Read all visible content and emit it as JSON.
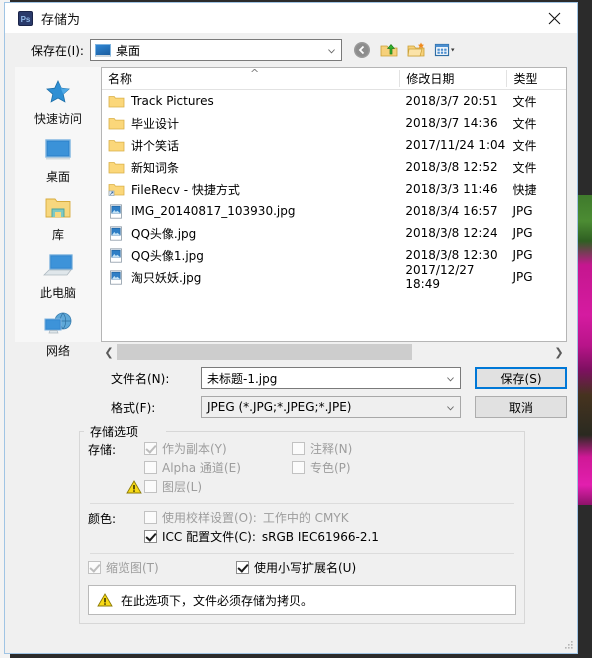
{
  "window": {
    "title": "存储为",
    "app_icon": "Ps",
    "close_icon": "close-icon"
  },
  "toolbar": {
    "save_in_label": "保存在(I):",
    "location_value": "桌面",
    "buttons": [
      {
        "name": "back-button",
        "icon": "back-arrow-icon",
        "label": ""
      },
      {
        "name": "up-one-level-button",
        "icon": "folder-up-icon",
        "label": ""
      },
      {
        "name": "new-folder-button",
        "icon": "new-folder-icon",
        "label": ""
      },
      {
        "name": "view-menu-button",
        "icon": "view-grid-icon",
        "label": ""
      }
    ]
  },
  "places": [
    {
      "label": "快速访问",
      "icon": "star-icon"
    },
    {
      "label": "桌面",
      "icon": "desktop-icon"
    },
    {
      "label": "库",
      "icon": "library-folder-icon"
    },
    {
      "label": "此电脑",
      "icon": "this-pc-icon"
    },
    {
      "label": "网络",
      "icon": "network-icon"
    }
  ],
  "filelist": {
    "columns": [
      "名称",
      "修改日期",
      "类型"
    ],
    "sort_indicator": "^",
    "rows": [
      {
        "name": "Track Pictures",
        "date": "2018/3/7 20:51",
        "type": "文件",
        "icon": "folder-icon"
      },
      {
        "name": "毕业设计",
        "date": "2018/3/7 14:36",
        "type": "文件",
        "icon": "folder-icon"
      },
      {
        "name": "讲个笑话",
        "date": "2017/11/24 1:04",
        "type": "文件",
        "icon": "folder-icon"
      },
      {
        "name": "新知词条",
        "date": "2018/3/8 12:52",
        "type": "文件",
        "icon": "folder-icon"
      },
      {
        "name": "FileRecv - 快捷方式",
        "date": "2018/3/3 11:46",
        "type": "快捷",
        "icon": "shortcut-folder-icon"
      },
      {
        "name": "IMG_20140817_103930.jpg",
        "date": "2018/3/4 16:57",
        "type": "JPG",
        "icon": "image-file-icon"
      },
      {
        "name": "QQ头像.jpg",
        "date": "2018/3/8 12:24",
        "type": "JPG",
        "icon": "image-file-icon"
      },
      {
        "name": "QQ头像1.jpg",
        "date": "2018/3/8 12:30",
        "type": "JPG",
        "icon": "image-file-icon"
      },
      {
        "name": "淘只妖妖.jpg",
        "date": "2017/12/27 18:49",
        "type": "JPG",
        "icon": "image-file-icon"
      }
    ],
    "scroll_left_icon": "chevron-left-icon",
    "scroll_right_icon": "chevron-right-icon"
  },
  "fields": {
    "filename_label": "文件名(N):",
    "filename_value": "未标题-1.jpg",
    "format_label": "格式(F):",
    "format_value": "JPEG (*.JPG;*.JPEG;*.JPE)"
  },
  "actions": {
    "save_label": "保存(S)",
    "cancel_label": "取消"
  },
  "save_options": {
    "group_title": "存储选项",
    "save_caption": "存储:",
    "color_caption": "颜色:",
    "as_copy": {
      "label": "作为副本(Y)",
      "checked": true,
      "disabled": true
    },
    "annotations": {
      "label": "注释(N)",
      "checked": false,
      "disabled": true
    },
    "alpha_channels": {
      "label": "Alpha 通道(E)",
      "checked": false,
      "disabled": true
    },
    "spot_colors": {
      "label": "专色(P)",
      "checked": false,
      "disabled": true
    },
    "layers": {
      "label": "图层(L)",
      "checked": false,
      "disabled": true,
      "warning": true
    },
    "use_proof_setup": {
      "label": "使用校样设置(O):",
      "value": "工作中的 CMYK",
      "checked": false,
      "disabled": true
    },
    "icc_profile": {
      "label": "ICC 配置文件(C):",
      "value": "sRGB IEC61966-2.1",
      "checked": true,
      "disabled": false
    },
    "thumbnail": {
      "label": "缩览图(T)",
      "checked": true,
      "disabled": true
    },
    "lowercase_ext": {
      "label": "使用小写扩展名(U)",
      "checked": true,
      "disabled": false
    },
    "warning_message": "在此选项下，文件必须存储为拷贝。"
  },
  "colors": {
    "accent": "#0078d7",
    "warning": "#f5d327",
    "folder": "#fbd77a",
    "dialog_bg": "#f0f0f0",
    "border": "#a0c4e4"
  }
}
